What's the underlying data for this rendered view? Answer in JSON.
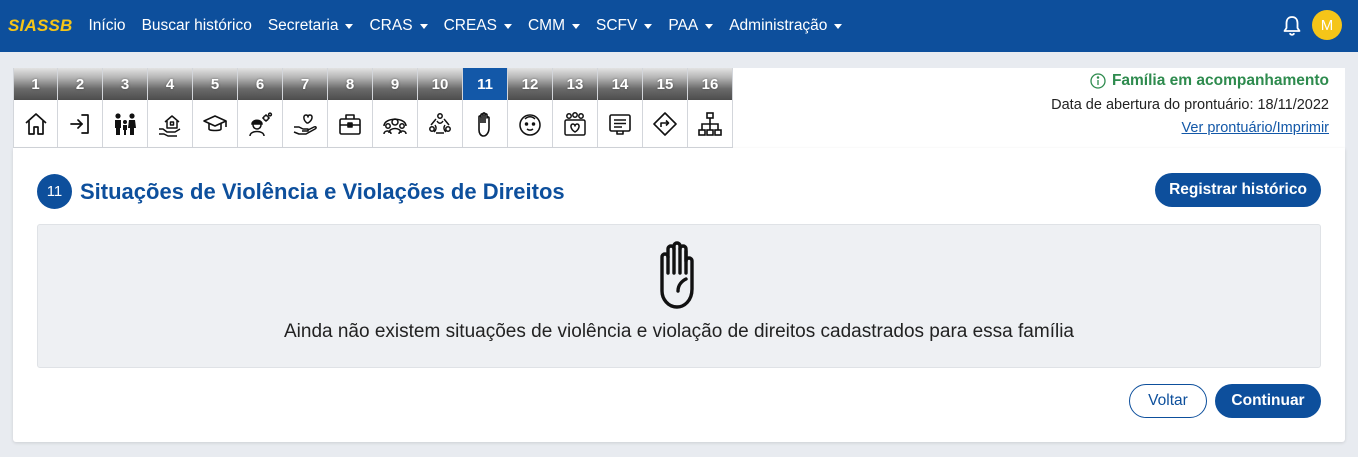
{
  "navbar": {
    "brand": "SIASSB",
    "items": [
      {
        "label": "Início",
        "dropdown": false
      },
      {
        "label": "Buscar histórico",
        "dropdown": false
      },
      {
        "label": "Secretaria",
        "dropdown": true
      },
      {
        "label": "CRAS",
        "dropdown": true
      },
      {
        "label": "CREAS",
        "dropdown": true
      },
      {
        "label": "CMM",
        "dropdown": true
      },
      {
        "label": "SCFV",
        "dropdown": true
      },
      {
        "label": "PAA",
        "dropdown": true
      },
      {
        "label": "Administração",
        "dropdown": true
      }
    ],
    "avatar_initial": "M",
    "bell_icon": "bell-icon"
  },
  "steps": [
    {
      "num": "1",
      "icon": "home-icon"
    },
    {
      "num": "2",
      "icon": "login-icon"
    },
    {
      "num": "3",
      "icon": "family-icon"
    },
    {
      "num": "4",
      "icon": "house-hand-icon"
    },
    {
      "num": "5",
      "icon": "graduation-cap-icon"
    },
    {
      "num": "6",
      "icon": "worker-gears-icon"
    },
    {
      "num": "7",
      "icon": "hand-heart-icon"
    },
    {
      "num": "8",
      "icon": "briefcase-icon"
    },
    {
      "num": "9",
      "icon": "people-group-icon"
    },
    {
      "num": "10",
      "icon": "recycle-people-icon"
    },
    {
      "num": "11",
      "icon": "stop-hand-icon",
      "active": true
    },
    {
      "num": "12",
      "icon": "child-face-icon"
    },
    {
      "num": "13",
      "icon": "heart-people-icon"
    },
    {
      "num": "14",
      "icon": "document-list-icon"
    },
    {
      "num": "15",
      "icon": "direction-sign-icon"
    },
    {
      "num": "16",
      "icon": "org-chart-icon"
    }
  ],
  "status": {
    "label": "Família em acompanhamento",
    "date_line": "Data de abertura do prontuário: 18/11/2022",
    "link": "Ver prontuário/Imprimir",
    "color": "#2e8b4e"
  },
  "section": {
    "number": "11",
    "title": "Situações de Violência e Violações de Direitos",
    "register_button": "Registrar histórico",
    "empty_message": "Ainda não existem situações de violência e violação de direitos cadastrados para essa família",
    "back_button": "Voltar",
    "continue_button": "Continuar"
  },
  "colors": {
    "primary": "#0d4f9c",
    "brand": "#f5c518",
    "active_step": "#1358a8"
  }
}
